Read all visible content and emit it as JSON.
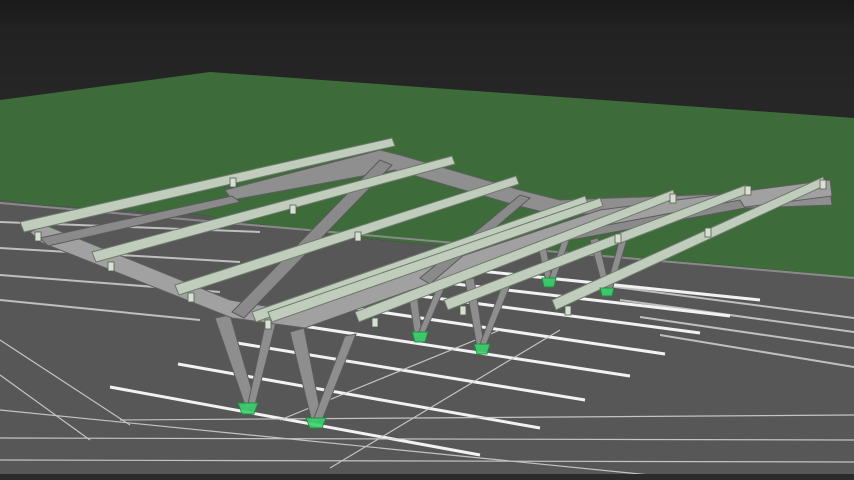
{
  "viewport": {
    "title": "",
    "colors": {
      "background": "#262626",
      "grass": "#3d6b3a",
      "asphalt": "#5a5a5a",
      "parking_lines": "#e8e8e8",
      "steel": "#9a9a9a",
      "steel_dark": "#6f6f6f",
      "rails": "#b8c7b4",
      "footings": "#39d46b"
    },
    "scene": {
      "objects": [
        "solar-carport-structure",
        "parking-lot",
        "grass-area"
      ],
      "rail_count": 8,
      "column_count": 6
    }
  }
}
